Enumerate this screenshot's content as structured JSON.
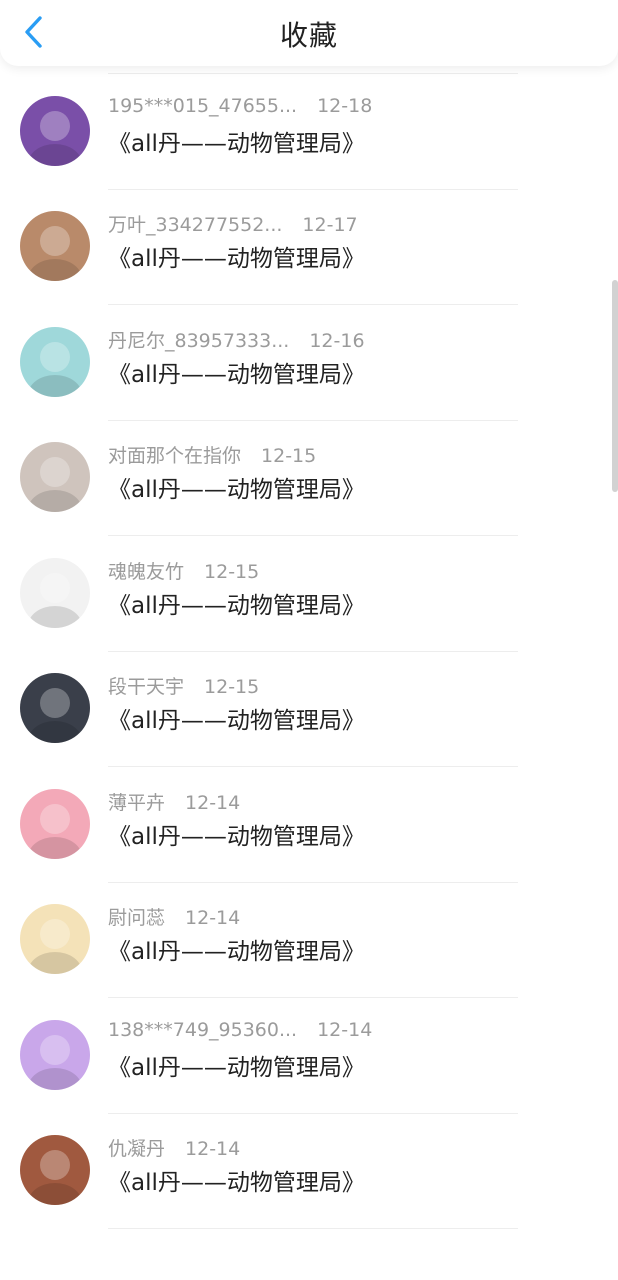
{
  "header": {
    "title": "收藏"
  },
  "work_title": "《all丹——动物管理局》",
  "items": [
    {
      "name": "",
      "date": "",
      "avatar_color": "#d9cfc6"
    },
    {
      "name": "195***015_47655...",
      "date": "12-18",
      "avatar_color": "#7a4fa8"
    },
    {
      "name": "万叶_334277552...",
      "date": "12-17",
      "avatar_color": "#b98a6a"
    },
    {
      "name": "丹尼尔_83957333...",
      "date": "12-16",
      "avatar_color": "#9fd8da"
    },
    {
      "name": "对面那个在指你",
      "date": "12-15",
      "avatar_color": "#cfc4bd"
    },
    {
      "name": "魂魄友竹",
      "date": "12-15",
      "avatar_color": "#f2f2f2"
    },
    {
      "name": "段干天宇",
      "date": "12-15",
      "avatar_color": "#3a3f4a"
    },
    {
      "name": "薄平卉",
      "date": "12-14",
      "avatar_color": "#f3a9b8"
    },
    {
      "name": "尉问蕊",
      "date": "12-14",
      "avatar_color": "#f4e2b8"
    },
    {
      "name": "138***749_95360...",
      "date": "12-14",
      "avatar_color": "#c9a7ea"
    },
    {
      "name": "仇凝丹",
      "date": "12-14",
      "avatar_color": "#a0593f"
    }
  ],
  "colors": {
    "accent": "#2a9df4",
    "meta": "#9b9b9b",
    "text": "#222222"
  }
}
